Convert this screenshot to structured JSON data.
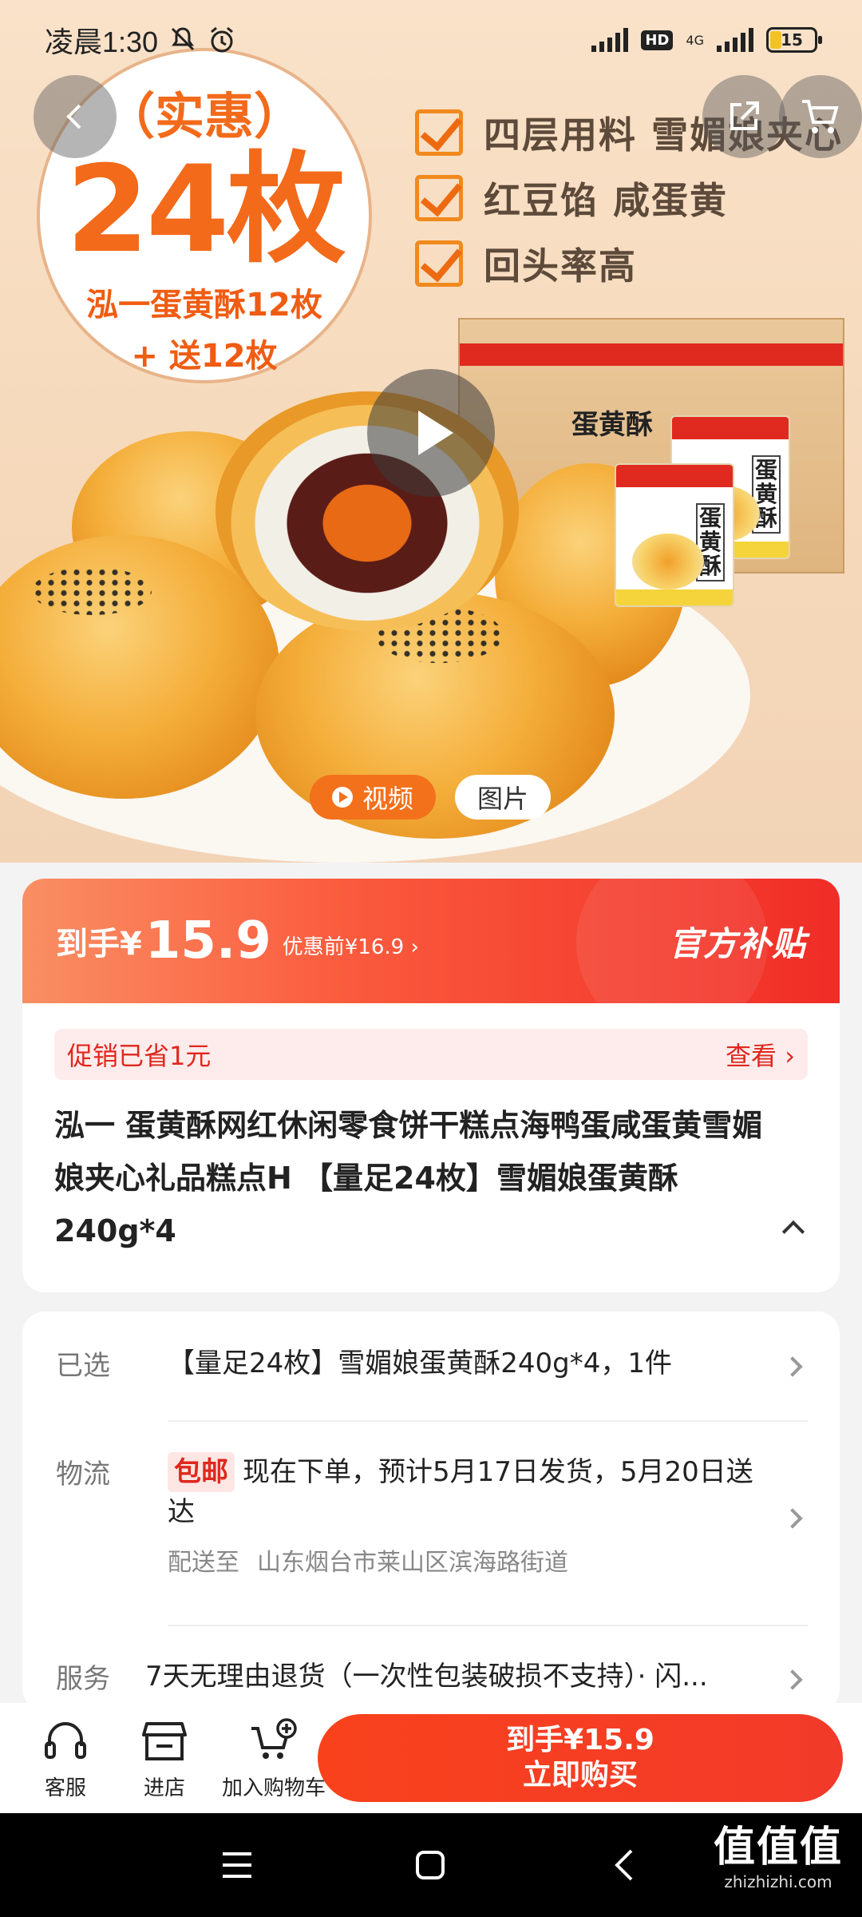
{
  "status_bar": {
    "time": "凌晨1:30",
    "hd": "HD",
    "network": "4G",
    "battery": "15"
  },
  "hero": {
    "badge_sub": "（实惠）",
    "badge_big": "24枚",
    "badge_line1": "泓一蛋黄酥12枚",
    "badge_line2": "+ 送12枚",
    "features": [
      "四层用料 雪媚娘夹心",
      "红豆馅 咸蛋黄",
      "回头率高"
    ],
    "box_label": "蛋黄酥",
    "pack_label": "蛋黄酥",
    "media_tabs": [
      {
        "label": "视频",
        "active": true
      },
      {
        "label": "图片",
        "active": false
      }
    ]
  },
  "price": {
    "prefix": "到手¥",
    "value": "15.9",
    "before": "优惠前¥16.9 ›",
    "subsidy": "官方补贴",
    "promo_text": "促销已省1元",
    "promo_link": "查看 ›"
  },
  "product": {
    "title": "泓一 蛋黄酥网红休闲零食饼干糕点海鸭蛋咸蛋黄雪媚娘夹心礼品糕点H 【量足24枚】雪媚娘蛋黄酥240g*4"
  },
  "details": {
    "selected_label": "已选",
    "selected_value": "【量足24枚】雪媚娘蛋黄酥240g*4，1件",
    "logistics_label": "物流",
    "free_shipping": "包邮",
    "logistics_value": "现在下单，预计5月17日发货，5月20日送达",
    "deliver_label": "配送至",
    "deliver_address": "山东烟台市莱山区滨海路街道",
    "service_label": "服务",
    "service_value": "7天无理由退货（一次性包装破损不支持）· 闪..."
  },
  "bottom_bar": {
    "service": "客服",
    "store": "进店",
    "cart": "加入购物车",
    "buy_price": "到手¥15.9",
    "buy_label": "立即购买"
  },
  "watermark": {
    "logo": "值值值",
    "url": "zhizhizhi.com"
  },
  "colors": {
    "accent": "#f02d27",
    "orange": "#f3711b",
    "background": "#f3f3f3"
  }
}
